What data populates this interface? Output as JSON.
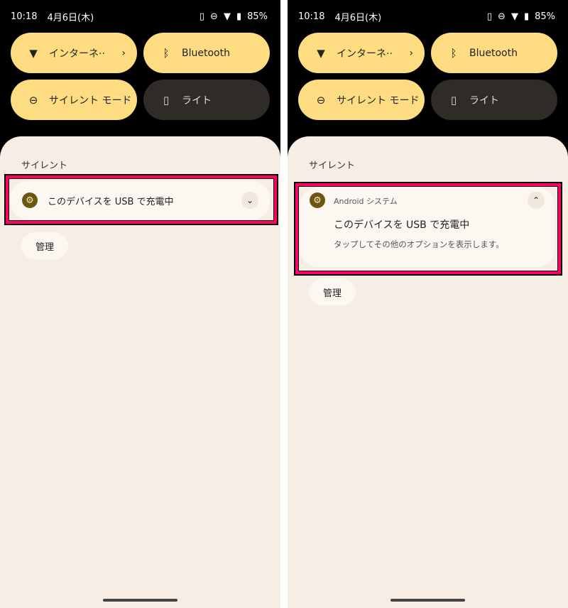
{
  "status": {
    "time": "10:18",
    "date": "4月6日(木)",
    "battery": "85%",
    "icons": [
      "vibrate-icon",
      "dnd-icon",
      "wifi-icon",
      "battery-icon"
    ]
  },
  "tiles": [
    {
      "label": "インターネ··",
      "icon": "wifi-icon",
      "active": true
    },
    {
      "label": "Bluetooth",
      "icon": "bluetooth-icon",
      "active": true
    },
    {
      "label": "サイレント モード",
      "icon": "dnd-icon",
      "active": true
    },
    {
      "label": "ライト",
      "icon": "flashlight-icon",
      "active": false
    }
  ],
  "section_label": "サイレント",
  "notification": {
    "app": "Android システム",
    "title": "このデバイスを USB で充電中",
    "text": "タップしてその他のオプションを表示します。"
  },
  "manage_label": "管理",
  "colors": {
    "tile_active": "#fddc82",
    "tile_inactive": "#2f2c27",
    "sheet": "#f6ede4",
    "highlight": "#ff0066"
  }
}
